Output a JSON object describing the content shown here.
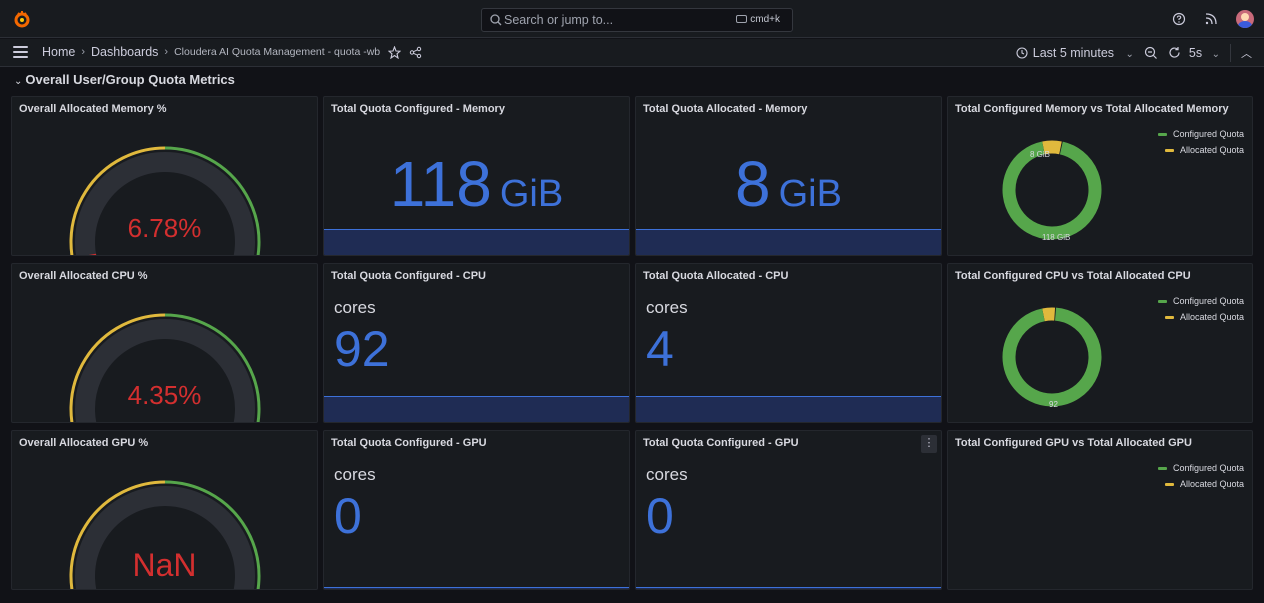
{
  "colors": {
    "ok": "#56a64b",
    "warn": "#e0b93d",
    "crit": "#d32f2f",
    "stat": "#3d71d9",
    "track": "#2c2f36"
  },
  "topbar": {
    "search_placeholder": "Search or jump to...",
    "shortcut": "cmd+k"
  },
  "navbar": {
    "breadcrumbs": [
      "Home",
      "Dashboards",
      "Cloudera AI Quota Management - quota -wb"
    ],
    "time_range": "Last 5 minutes",
    "refresh_interval": "5s"
  },
  "row": {
    "title": "Overall User/Group Quota Metrics"
  },
  "panels": {
    "mem_gauge": {
      "title": "Overall Allocated Memory %",
      "value": "6.78%",
      "level": 0.0678
    },
    "cpu_gauge": {
      "title": "Overall Allocated CPU %",
      "value": "4.35%",
      "level": 0.0435
    },
    "gpu_gauge": {
      "title": "Overall Allocated GPU %",
      "value": "NaN",
      "level": 0
    },
    "mem_conf": {
      "title": "Total Quota Configured - Memory",
      "value": "118",
      "unit": "GiB"
    },
    "mem_alloc": {
      "title": "Total Quota Allocated - Memory",
      "value": "8",
      "unit": "GiB"
    },
    "cpu_conf": {
      "title": "Total Quota Configured - CPU",
      "unit": "cores",
      "value": "92"
    },
    "cpu_alloc": {
      "title": "Total Quota Allocated - CPU",
      "unit": "cores",
      "value": "4"
    },
    "gpu_conf": {
      "title": "Total Quota Configured - GPU",
      "unit": "cores",
      "value": "0"
    },
    "gpu_conf2": {
      "title": "Total Quota Configured - GPU",
      "unit": "cores",
      "value": "0"
    },
    "mem_pie": {
      "title": "Total Configured Memory vs Total Allocated Memory",
      "configured_label": "118 GiB",
      "allocated_label": "8 GiB",
      "configured": 118,
      "allocated": 8
    },
    "cpu_pie": {
      "title": "Total Configured CPU vs Total Allocated CPU",
      "configured_label": "92",
      "allocated_label": "",
      "configured": 92,
      "allocated": 4
    },
    "gpu_pie": {
      "title": "Total Configured GPU vs Total Allocated GPU"
    }
  },
  "legend": {
    "configured": "Configured Quota",
    "allocated": "Allocated Quota"
  }
}
